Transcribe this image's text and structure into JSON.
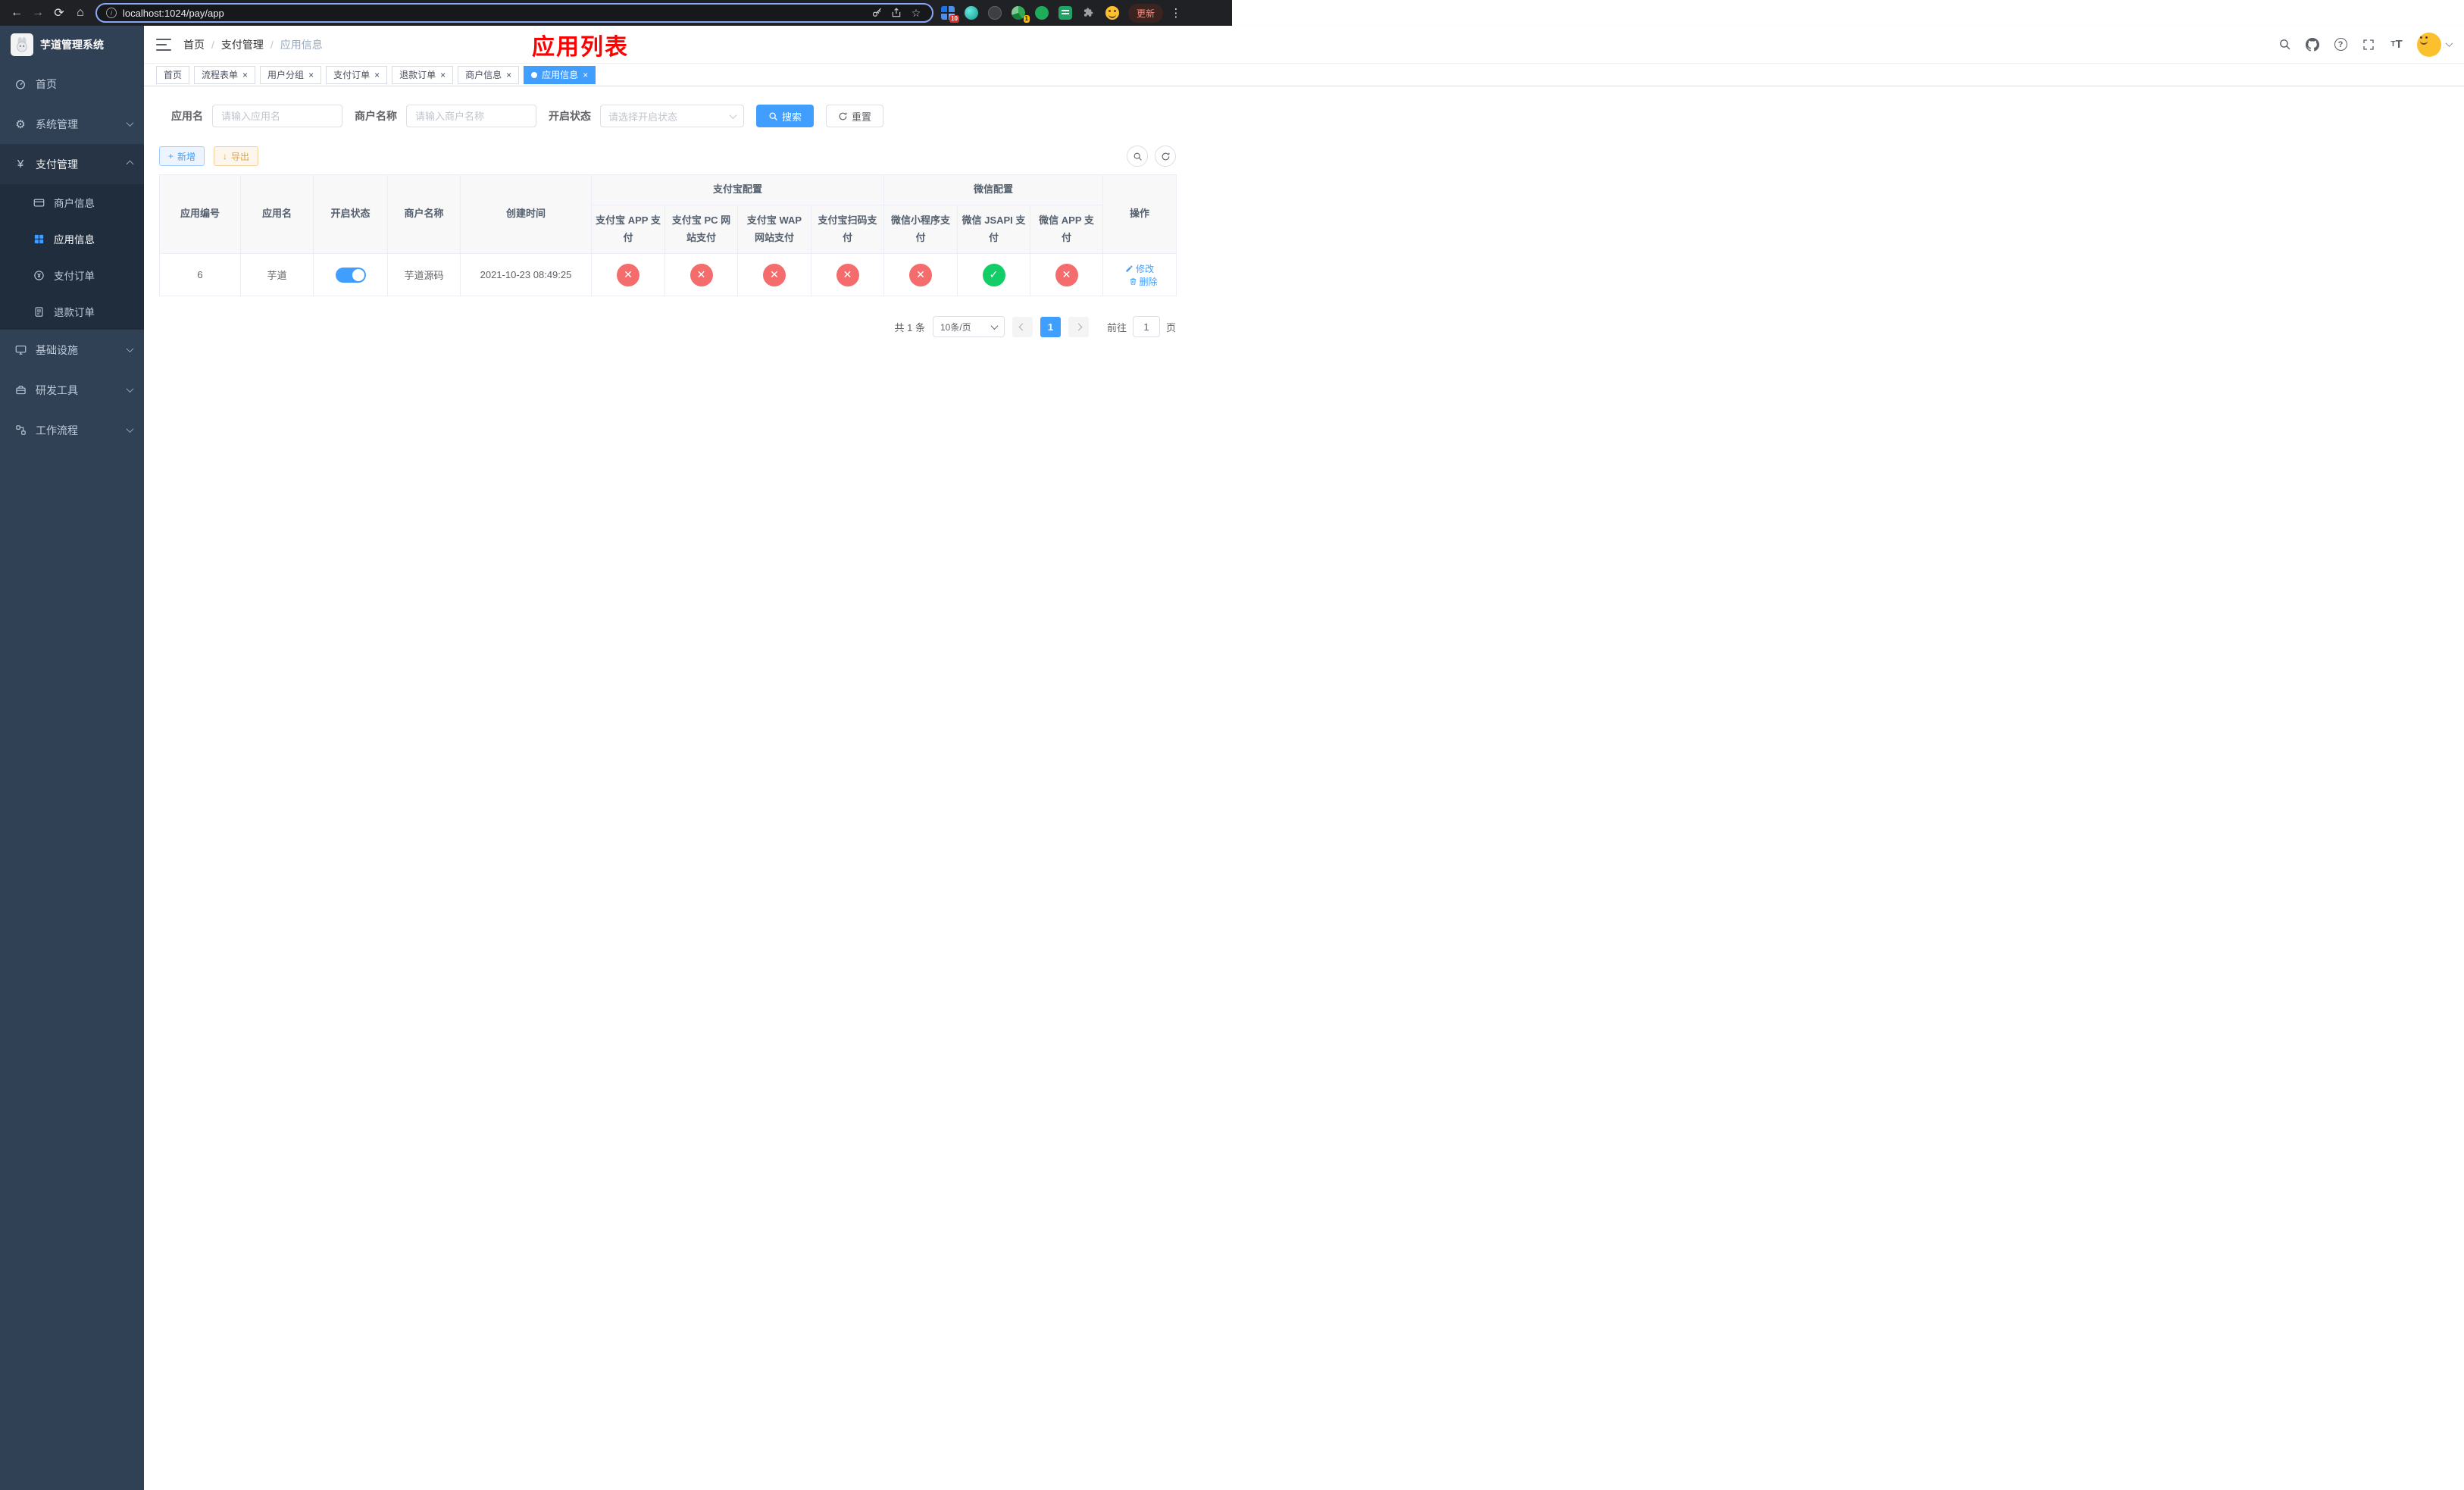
{
  "colors": {
    "primary": "#409eff",
    "success": "#13ce66",
    "danger": "#f56c6c",
    "warning": "#e6a23c",
    "annotation": "#ff0000",
    "sidebar_bg": "#304156",
    "submenu_bg": "#1f2d3d"
  },
  "browser": {
    "url": "localhost:1024/pay/app",
    "update_label": "更新",
    "extension_badge_grid": "10",
    "extension_badge_one": "1"
  },
  "sidebar": {
    "title": "芋道管理系统",
    "menu": [
      {
        "label": "首页"
      },
      {
        "label": "系统管理"
      },
      {
        "label": "支付管理"
      },
      {
        "label": "基础设施"
      },
      {
        "label": "研发工具"
      },
      {
        "label": "工作流程"
      }
    ],
    "payment_submenu": [
      {
        "label": "商户信息"
      },
      {
        "label": "应用信息"
      },
      {
        "label": "支付订单"
      },
      {
        "label": "退款订单"
      }
    ]
  },
  "header": {
    "breadcrumb": [
      "首页",
      "支付管理",
      "应用信息"
    ],
    "annotation": "应用列表"
  },
  "tabs": [
    {
      "label": "首页"
    },
    {
      "label": "流程表单"
    },
    {
      "label": "用户分组"
    },
    {
      "label": "支付订单"
    },
    {
      "label": "退款订单"
    },
    {
      "label": "商户信息"
    },
    {
      "label": "应用信息"
    }
  ],
  "filters": {
    "app_name_label": "应用名",
    "app_name_placeholder": "请输入应用名",
    "merchant_name_label": "商户名称",
    "merchant_name_placeholder": "请输入商户名称",
    "status_label": "开启状态",
    "status_placeholder": "请选择开启状态",
    "search_button": "搜索",
    "reset_button": "重置"
  },
  "toolbar": {
    "add_button": "新增",
    "export_button": "导出"
  },
  "table": {
    "group_alipay": "支付宝配置",
    "group_wechat": "微信配置",
    "columns": {
      "id": "应用编号",
      "name": "应用名",
      "status": "开启状态",
      "merchant": "商户名称",
      "created": "创建时间",
      "alipay_app": "支付宝 APP 支付",
      "alipay_pc": "支付宝 PC 网站支付",
      "alipay_wap": "支付宝 WAP 网站支付",
      "alipay_qr": "支付宝扫码支付",
      "wx_lite": "微信小程序支付",
      "wx_jsapi": "微信 JSAPI 支付",
      "wx_app": "微信 APP 支付",
      "actions": "操作"
    },
    "rows": [
      {
        "id": "6",
        "name": "芋道",
        "enabled": true,
        "merchant": "芋道源码",
        "created": "2021-10-23 08:49:25",
        "configs": [
          "fail",
          "fail",
          "fail",
          "fail",
          "fail",
          "success",
          "fail"
        ],
        "edit_label": "修改",
        "delete_label": "删除"
      }
    ]
  },
  "pagination": {
    "total": "共 1 条",
    "page_size": "10条/页",
    "page": "1",
    "goto_label": "前往",
    "goto_value": "1",
    "page_unit": "页"
  },
  "icons": {
    "back": "←",
    "forward": "→",
    "reload": "⟳",
    "home": "⌂",
    "info": "i",
    "star": "☆",
    "kebab": "⋮",
    "close": "×",
    "plus": "+",
    "download": "↓",
    "help": "?",
    "yen": "¥",
    "gear": "⚙",
    "fail_glyph": "✕",
    "success_glyph": "✓"
  }
}
